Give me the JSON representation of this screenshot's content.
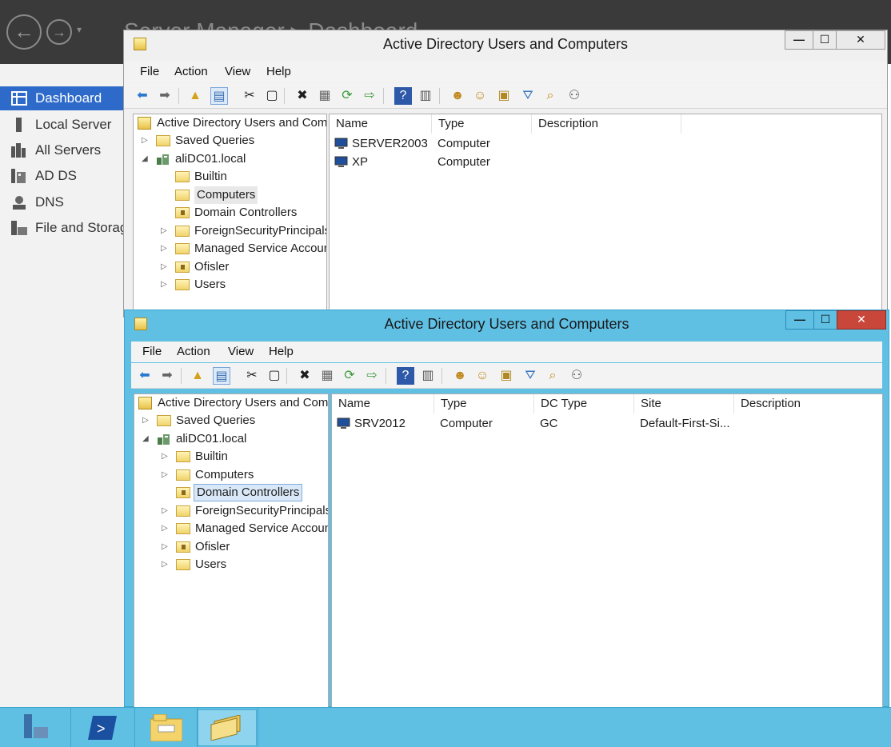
{
  "server_manager": {
    "title": "Server Manager ▸ Dashboard",
    "sidebar": [
      {
        "label": "Dashboard",
        "icon": "dashboard-icon",
        "active": true
      },
      {
        "label": "Local Server",
        "icon": "local-server-icon",
        "active": false
      },
      {
        "label": "All Servers",
        "icon": "all-servers-icon",
        "active": false
      },
      {
        "label": "AD DS",
        "icon": "ad-ds-icon",
        "active": false
      },
      {
        "label": "DNS",
        "icon": "dns-icon",
        "active": false
      },
      {
        "label": "File and Storage Services",
        "icon": "file-storage-icon",
        "active": false
      }
    ]
  },
  "window_back": {
    "title": "Active Directory Users and Computers",
    "menu": [
      "File",
      "Action",
      "View",
      "Help"
    ],
    "tree": {
      "root": "Active Directory Users and Computers",
      "saved_queries": "Saved Queries",
      "domain": "aliDC01.local",
      "children": [
        "Builtin",
        "Computers",
        "Domain Controllers",
        "ForeignSecurityPrincipals",
        "Managed Service Accounts",
        "Ofisler",
        "Users"
      ],
      "selected": "Computers"
    },
    "columns": [
      "Name",
      "Type",
      "Description"
    ],
    "rows": [
      {
        "name": "SERVER2003",
        "type": "Computer",
        "description": ""
      },
      {
        "name": "XP",
        "type": "Computer",
        "description": ""
      }
    ]
  },
  "window_front": {
    "title": "Active Directory Users and Computers",
    "menu": [
      "File",
      "Action",
      "View",
      "Help"
    ],
    "tree": {
      "root": "Active Directory Users and Computers",
      "saved_queries": "Saved Queries",
      "domain": "aliDC01.local",
      "children": [
        "Builtin",
        "Computers",
        "Domain Controllers",
        "ForeignSecurityPrincipals",
        "Managed Service Accounts",
        "Ofisler",
        "Users"
      ],
      "selected": "Domain Controllers"
    },
    "columns": [
      "Name",
      "Type",
      "DC Type",
      "Site",
      "Description"
    ],
    "rows": [
      {
        "name": "SRV2012",
        "type": "Computer",
        "dc_type": "GC",
        "site": "Default-First-Si...",
        "description": ""
      }
    ]
  },
  "taskbar": [
    {
      "name": "server-manager-task",
      "icon": "server-manager-icon"
    },
    {
      "name": "powershell-task",
      "icon": "powershell-icon"
    },
    {
      "name": "explorer-task",
      "icon": "file-explorer-icon"
    },
    {
      "name": "aduc-task",
      "icon": "aduc-icon",
      "active": true
    }
  ],
  "colors": {
    "active_frame": "#5fc0e4",
    "sidebar_active": "#2e6ac9",
    "close_button": "#c8463a"
  }
}
